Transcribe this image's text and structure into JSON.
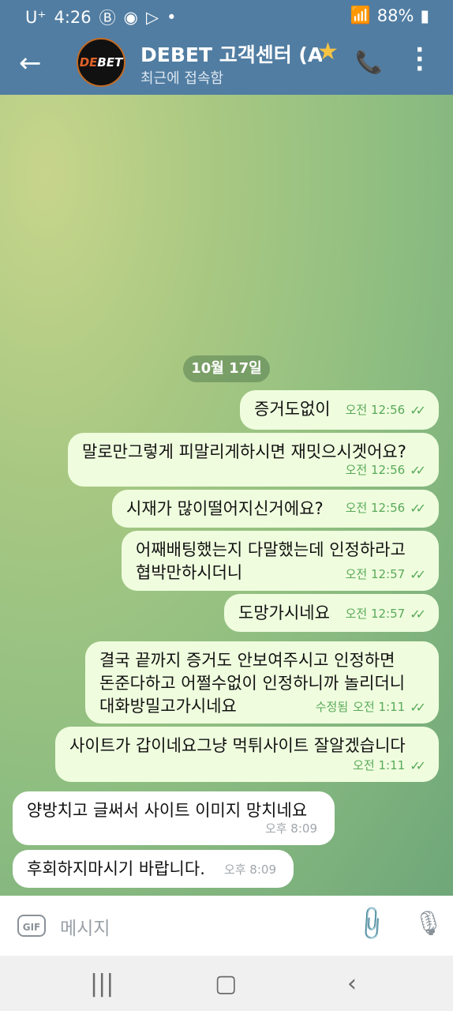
{
  "status": {
    "carrier": "U⁺",
    "time": "4:26",
    "battery": "88%"
  },
  "header": {
    "title": "DEBET 고객센터 (A",
    "subtitle": "최근에 접속함",
    "avatar_text": "DEBET"
  },
  "date_chip": "10월 17일",
  "messages": [
    {
      "text": "증거도없이",
      "time": "오전 12:56"
    },
    {
      "text": "말로만그렇게 피말리게하시면 재밋으시겟어요?",
      "time": "오전 12:56"
    },
    {
      "text": "시재가 많이떨어지신거에요?",
      "time": "오전 12:56"
    },
    {
      "text": "어째배팅했는지 다말했는데 인정하라고\n협박만하시더니",
      "time": "오전 12:57"
    },
    {
      "text": "도망가시네요",
      "time": "오전 12:57"
    },
    {
      "text": "결국 끝까지 증거도 안보여주시고 인정하면\n돈준다하고 어쩔수없이 인정하니까 놀리더니\n대화방밀고가시네요",
      "edited": "수정됨",
      "time": "오전 1:11"
    },
    {
      "text": "사이트가 갑이네요그냥 먹튀사이트 잘알겠습니다",
      "time": "오전 1:11"
    },
    {
      "text": "양방치고 글써서 사이트 이미지 망치네요",
      "time": "오후 8:09"
    },
    {
      "text": "후회하지마시기 바랍니다.",
      "time": "오후 8:09"
    }
  ],
  "input": {
    "gif_label": "GIF",
    "placeholder": "메시지"
  },
  "colors": {
    "header": "#517da2",
    "outgoing_bubble": "#effdde",
    "incoming_bubble": "#ffffff",
    "check": "#5aa95a"
  },
  "icons": [
    "back-arrow-icon",
    "star-icon",
    "phone-icon",
    "more-vert-icon",
    "attach-icon",
    "mic-icon"
  ]
}
